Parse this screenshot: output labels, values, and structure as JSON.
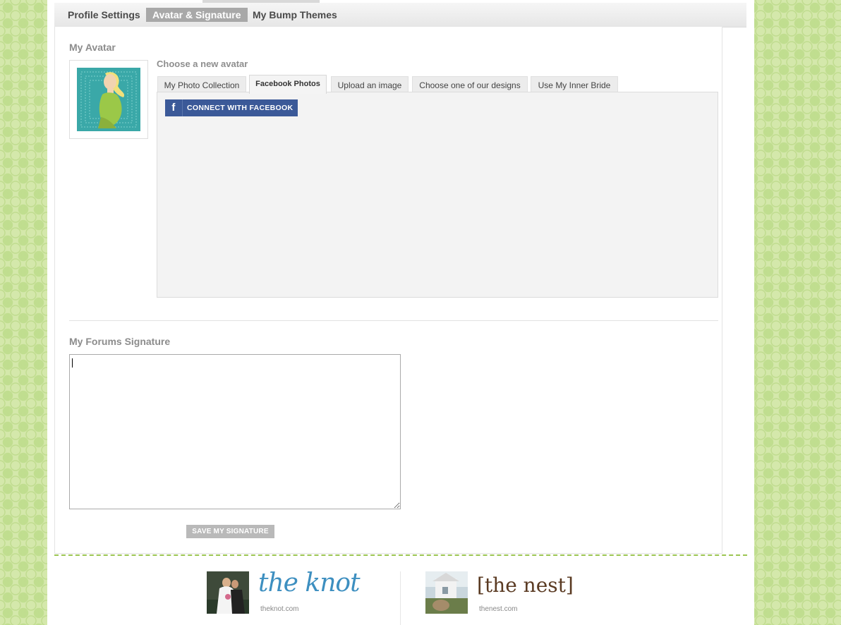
{
  "tabs": {
    "profile_settings": "Profile Settings",
    "avatar_signature": "Avatar & Signature",
    "bump_themes": "My Bump Themes"
  },
  "avatar": {
    "heading": "My Avatar",
    "choose_label": "Choose a new avatar",
    "tabs": [
      {
        "label": "My Photo Collection",
        "active": false
      },
      {
        "label": "Facebook Photos",
        "active": true
      },
      {
        "label": "Upload an image",
        "active": false
      },
      {
        "label": "Choose one of our designs",
        "active": false
      },
      {
        "label": "Use My Inner Bride",
        "active": false
      }
    ],
    "connect_facebook": "CONNECT WITH FACEBOOK",
    "facebook_glyph": "f"
  },
  "signature": {
    "heading": "My Forums Signature",
    "value": "",
    "save_label": "SAVE MY SIGNATURE"
  },
  "footer": {
    "knot": {
      "logo_text": "the knot",
      "url": "theknot.com"
    },
    "nest": {
      "logo_text": "[the nest]",
      "url": "thenest.com"
    }
  },
  "colors": {
    "facebook_blue": "#3b5998",
    "active_tab": "#a8a8a8",
    "knot_blue": "#3d8fc0",
    "nest_brown": "#5a3a22",
    "background_green": "#d4e8ab"
  }
}
